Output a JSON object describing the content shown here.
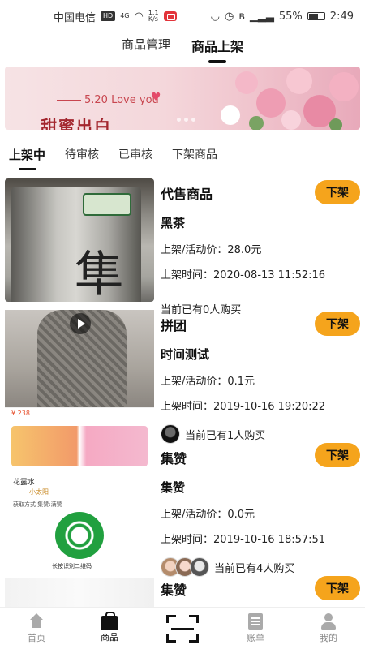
{
  "status_bar": {
    "carrier": "中国电信",
    "hd_badge": "HD",
    "network": "4G",
    "speed": "1.1\nK/s",
    "battery": "55%",
    "time": "2:49"
  },
  "top_tabs": [
    {
      "label": "商品管理",
      "active": false
    },
    {
      "label": "商品上架",
      "active": true
    }
  ],
  "banner": {
    "subtitle": "5.20 Love you",
    "title": "甜蜜出白",
    "dots": 3
  },
  "sub_tabs": [
    {
      "label": "上架中",
      "active": true
    },
    {
      "label": "待审核",
      "active": false
    },
    {
      "label": "已审核",
      "active": false
    },
    {
      "label": "下架商品",
      "active": false
    }
  ],
  "products": [
    {
      "category": "代售商品",
      "name": "黑茶",
      "price_line": "上架/活动价：28.0元",
      "time_line": "上架时间：2020-08-13 11:52:16",
      "buyers_text": "当前已有0人购买",
      "action_label": "下架"
    },
    {
      "category": "拼团",
      "name": "时间测试",
      "price_line": "上架/活动价：0.1元",
      "time_line": "上架时间：2019-10-16 19:20:22",
      "buyers_text": "当前已有1人购买",
      "action_label": "下架"
    },
    {
      "category": "集赞",
      "name": "集赞",
      "price_line": "上架/活动价：0.0元",
      "time_line": "上架时间：2019-10-16 18:57:51",
      "buyers_text": "当前已有4人购买",
      "action_label": "下架"
    },
    {
      "category": "集赞",
      "action_label": "下架"
    }
  ],
  "image_texts": {
    "tea_can_char": "隼",
    "poster_price": "¥ 238",
    "poster_name": "花露水",
    "poster_nick": "小太阳",
    "poster_method": "获取方式    集赞:满赞",
    "poster_qr_caption": "长按识别二维码"
  },
  "bottom_nav": [
    {
      "label": "首页",
      "icon": "home-icon",
      "active": false
    },
    {
      "label": "商品",
      "icon": "bag-icon",
      "active": true
    },
    {
      "label": "",
      "icon": "scan-icon",
      "active": false
    },
    {
      "label": "账单",
      "icon": "bill-icon",
      "active": false
    },
    {
      "label": "我的",
      "icon": "user-icon",
      "active": false
    }
  ],
  "colors": {
    "accent": "#f5a41c",
    "text": "#111111",
    "muted": "#888888"
  }
}
